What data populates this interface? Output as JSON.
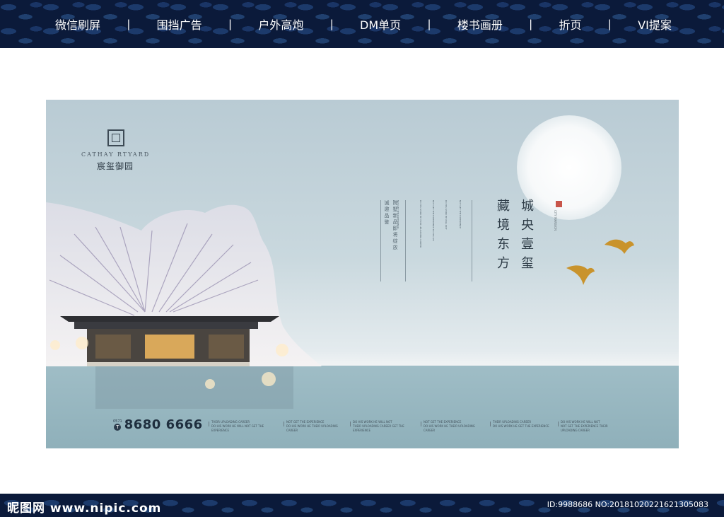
{
  "nav": {
    "items": [
      "微信刷屏",
      "围挡广告",
      "户外高炮",
      "DM单页",
      "楼书画册",
      "折页",
      "VI提案"
    ],
    "separator": "|"
  },
  "poster": {
    "brand_en": "CATHAY RTYARD",
    "brand_cn": "宸玺御园",
    "headline_col1": "城央壹玺",
    "headline_col2": "藏境东方",
    "seal_text": "CITY MANSION",
    "subtitle_col1": "院墅新品即将绽放",
    "subtitle_col2": "诚邀品鉴",
    "tiny_col1": "NOT GET THE EXPERIENCE",
    "tiny_col2": "DO HIS WORK HE WILL NOT",
    "tiny_col3": "NOT GET THE EXPERIENCE DO HIS WO",
    "tiny_col4": "DO HIS WORK HE YOUR UPLOADING CAREER",
    "tiny_col5": "NOT GET THE EXPERIENCE",
    "phone_area": "0571",
    "phone_badge": "T",
    "phone_number": "8680 6666",
    "footnotes": [
      "THEIR UPLOADING CAREER\nDO HIS WORK HE WILL NOT GET THE EXPERIENCE",
      "NOT GET THE EXPERIENCE\nDO HIS WORK HE THEIR UPLOADING CAREER",
      "DO HIS WORK HE WILL NOT\nTHEIR UPLOADING CAREER GET THE EXPERIENCE",
      "NOT GET THE EXPERIENCE\nDO HIS WORK HE THEIR UPLOADING CAREER",
      "THEIR UPLOADING CAREER\nDO HIS WORK HE GET THE EXPERIENCE",
      "DO HIS WORK HE WILL NOT\nNOT GET THE EXPERIENCE THEIR UPLOADING CAREER"
    ]
  },
  "footer": {
    "logo": "昵图网 www.nipic.com",
    "id_text": "ID:9988686 NO:20181020221621305083"
  },
  "colors": {
    "band": "#0b1a3a",
    "sky": "#c9d8de",
    "water": "#8fb0ba",
    "accent_gold": "#c9932c",
    "seal_red": "#c8554a"
  }
}
